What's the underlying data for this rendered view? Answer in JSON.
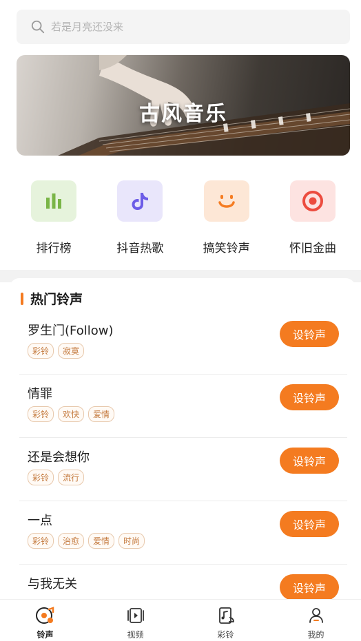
{
  "search": {
    "placeholder": "若是月亮还没来"
  },
  "banner": {
    "title": "古风音乐"
  },
  "categories": [
    {
      "label": "排行榜",
      "icon": "bar-chart-icon",
      "bg": "#e6f3dc",
      "color": "#7ab547"
    },
    {
      "label": "抖音热歌",
      "icon": "tiktok-icon",
      "bg": "#e9e6fb",
      "color": "#6c5ce7"
    },
    {
      "label": "搞笑铃声",
      "icon": "smile-icon",
      "bg": "#fde7d6",
      "color": "#f57c22"
    },
    {
      "label": "怀旧金曲",
      "icon": "target-icon",
      "bg": "#fde3e1",
      "color": "#ec4c3f"
    }
  ],
  "hot": {
    "title": "热门铃声",
    "button_label": "设铃声",
    "items": [
      {
        "name": "罗生门(Follow)",
        "tags": [
          "彩铃",
          "寂寞"
        ]
      },
      {
        "name": "情罪",
        "tags": [
          "彩铃",
          "欢快",
          "爱情"
        ]
      },
      {
        "name": "还是会想你",
        "tags": [
          "彩铃",
          "流行"
        ]
      },
      {
        "name": "一点",
        "tags": [
          "彩铃",
          "治愈",
          "爱情",
          "时尚"
        ]
      },
      {
        "name": "与我无关",
        "tags": []
      }
    ]
  },
  "tabbar": [
    {
      "label": "铃声",
      "icon": "ringtone-icon",
      "active": true
    },
    {
      "label": "视频",
      "icon": "video-icon",
      "active": false
    },
    {
      "label": "彩铃",
      "icon": "color-ring-icon",
      "active": false
    },
    {
      "label": "我的",
      "icon": "profile-icon",
      "active": false
    }
  ],
  "colors": {
    "accent": "#f47b20"
  }
}
